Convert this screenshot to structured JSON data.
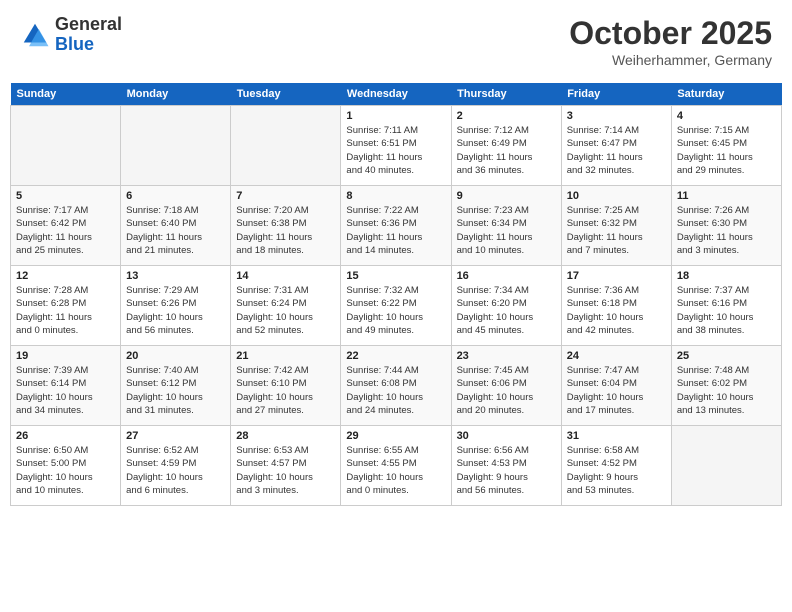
{
  "header": {
    "logo_general": "General",
    "logo_blue": "Blue",
    "month": "October 2025",
    "location": "Weiherhammer, Germany"
  },
  "weekdays": [
    "Sunday",
    "Monday",
    "Tuesday",
    "Wednesday",
    "Thursday",
    "Friday",
    "Saturday"
  ],
  "weeks": [
    [
      {
        "day": "",
        "info": ""
      },
      {
        "day": "",
        "info": ""
      },
      {
        "day": "",
        "info": ""
      },
      {
        "day": "1",
        "info": "Sunrise: 7:11 AM\nSunset: 6:51 PM\nDaylight: 11 hours\nand 40 minutes."
      },
      {
        "day": "2",
        "info": "Sunrise: 7:12 AM\nSunset: 6:49 PM\nDaylight: 11 hours\nand 36 minutes."
      },
      {
        "day": "3",
        "info": "Sunrise: 7:14 AM\nSunset: 6:47 PM\nDaylight: 11 hours\nand 32 minutes."
      },
      {
        "day": "4",
        "info": "Sunrise: 7:15 AM\nSunset: 6:45 PM\nDaylight: 11 hours\nand 29 minutes."
      }
    ],
    [
      {
        "day": "5",
        "info": "Sunrise: 7:17 AM\nSunset: 6:42 PM\nDaylight: 11 hours\nand 25 minutes."
      },
      {
        "day": "6",
        "info": "Sunrise: 7:18 AM\nSunset: 6:40 PM\nDaylight: 11 hours\nand 21 minutes."
      },
      {
        "day": "7",
        "info": "Sunrise: 7:20 AM\nSunset: 6:38 PM\nDaylight: 11 hours\nand 18 minutes."
      },
      {
        "day": "8",
        "info": "Sunrise: 7:22 AM\nSunset: 6:36 PM\nDaylight: 11 hours\nand 14 minutes."
      },
      {
        "day": "9",
        "info": "Sunrise: 7:23 AM\nSunset: 6:34 PM\nDaylight: 11 hours\nand 10 minutes."
      },
      {
        "day": "10",
        "info": "Sunrise: 7:25 AM\nSunset: 6:32 PM\nDaylight: 11 hours\nand 7 minutes."
      },
      {
        "day": "11",
        "info": "Sunrise: 7:26 AM\nSunset: 6:30 PM\nDaylight: 11 hours\nand 3 minutes."
      }
    ],
    [
      {
        "day": "12",
        "info": "Sunrise: 7:28 AM\nSunset: 6:28 PM\nDaylight: 11 hours\nand 0 minutes."
      },
      {
        "day": "13",
        "info": "Sunrise: 7:29 AM\nSunset: 6:26 PM\nDaylight: 10 hours\nand 56 minutes."
      },
      {
        "day": "14",
        "info": "Sunrise: 7:31 AM\nSunset: 6:24 PM\nDaylight: 10 hours\nand 52 minutes."
      },
      {
        "day": "15",
        "info": "Sunrise: 7:32 AM\nSunset: 6:22 PM\nDaylight: 10 hours\nand 49 minutes."
      },
      {
        "day": "16",
        "info": "Sunrise: 7:34 AM\nSunset: 6:20 PM\nDaylight: 10 hours\nand 45 minutes."
      },
      {
        "day": "17",
        "info": "Sunrise: 7:36 AM\nSunset: 6:18 PM\nDaylight: 10 hours\nand 42 minutes."
      },
      {
        "day": "18",
        "info": "Sunrise: 7:37 AM\nSunset: 6:16 PM\nDaylight: 10 hours\nand 38 minutes."
      }
    ],
    [
      {
        "day": "19",
        "info": "Sunrise: 7:39 AM\nSunset: 6:14 PM\nDaylight: 10 hours\nand 34 minutes."
      },
      {
        "day": "20",
        "info": "Sunrise: 7:40 AM\nSunset: 6:12 PM\nDaylight: 10 hours\nand 31 minutes."
      },
      {
        "day": "21",
        "info": "Sunrise: 7:42 AM\nSunset: 6:10 PM\nDaylight: 10 hours\nand 27 minutes."
      },
      {
        "day": "22",
        "info": "Sunrise: 7:44 AM\nSunset: 6:08 PM\nDaylight: 10 hours\nand 24 minutes."
      },
      {
        "day": "23",
        "info": "Sunrise: 7:45 AM\nSunset: 6:06 PM\nDaylight: 10 hours\nand 20 minutes."
      },
      {
        "day": "24",
        "info": "Sunrise: 7:47 AM\nSunset: 6:04 PM\nDaylight: 10 hours\nand 17 minutes."
      },
      {
        "day": "25",
        "info": "Sunrise: 7:48 AM\nSunset: 6:02 PM\nDaylight: 10 hours\nand 13 minutes."
      }
    ],
    [
      {
        "day": "26",
        "info": "Sunrise: 6:50 AM\nSunset: 5:00 PM\nDaylight: 10 hours\nand 10 minutes."
      },
      {
        "day": "27",
        "info": "Sunrise: 6:52 AM\nSunset: 4:59 PM\nDaylight: 10 hours\nand 6 minutes."
      },
      {
        "day": "28",
        "info": "Sunrise: 6:53 AM\nSunset: 4:57 PM\nDaylight: 10 hours\nand 3 minutes."
      },
      {
        "day": "29",
        "info": "Sunrise: 6:55 AM\nSunset: 4:55 PM\nDaylight: 10 hours\nand 0 minutes."
      },
      {
        "day": "30",
        "info": "Sunrise: 6:56 AM\nSunset: 4:53 PM\nDaylight: 9 hours\nand 56 minutes."
      },
      {
        "day": "31",
        "info": "Sunrise: 6:58 AM\nSunset: 4:52 PM\nDaylight: 9 hours\nand 53 minutes."
      },
      {
        "day": "",
        "info": ""
      }
    ]
  ]
}
